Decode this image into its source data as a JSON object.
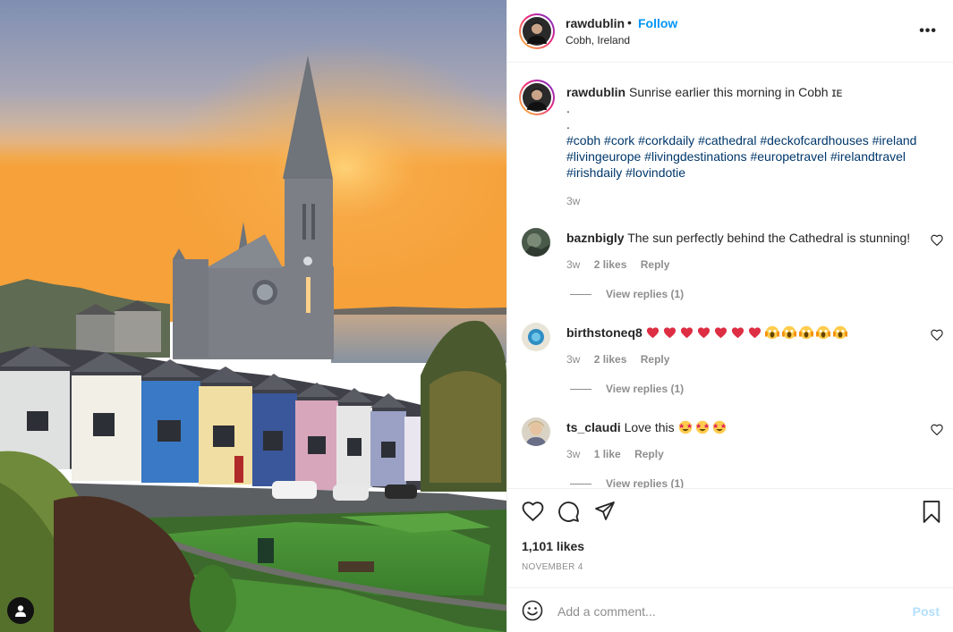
{
  "post": {
    "username": "rawdublin",
    "follow_label": "Follow",
    "separator": "•",
    "location": "Cobh, Ireland",
    "more_label": "•••"
  },
  "caption": {
    "username": "rawdublin",
    "text": "Sunrise earlier this morning in Cobh ɪᴇ",
    "dot1": ".",
    "dot2": ".",
    "hashtags_line1": "#cobh #cork #corkdaily #cathedral #deckofcardhouses #ireland",
    "hashtags_line2": "#livingeurope #livingdestinations #europetravel #irelandtravel",
    "hashtags_line3": "#irishdaily #lovindotie",
    "time": "3w"
  },
  "comments": [
    {
      "username": "baznbigly",
      "text": "The sun perfectly behind the Cathedral is stunning!",
      "time": "3w",
      "likes": "2 likes",
      "reply_label": "Reply",
      "view_replies": "View replies (1)"
    },
    {
      "username": "birthstoneq8",
      "text": "",
      "emojis": "7 red hearts, 5 screaming faces",
      "time": "3w",
      "likes": "2 likes",
      "reply_label": "Reply",
      "view_replies": "View replies (1)"
    },
    {
      "username": "ts_claudi",
      "text": "Love this",
      "emojis": "3 star-struck faces",
      "time": "3w",
      "likes": "1 like",
      "reply_label": "Reply",
      "view_replies": "View replies (1)"
    }
  ],
  "actions": {
    "likes_count": "1,101 likes",
    "date": "NOVEMBER 4",
    "icons": [
      "heart-icon",
      "comment-icon",
      "share-icon",
      "bookmark-icon"
    ]
  },
  "composer": {
    "placeholder": "Add a comment...",
    "post_label": "Post"
  },
  "colors": {
    "link_blue": "#0095f6",
    "hashtag": "#00376b",
    "muted": "#8e8e8e",
    "post_disabled": "#b2dffc"
  }
}
